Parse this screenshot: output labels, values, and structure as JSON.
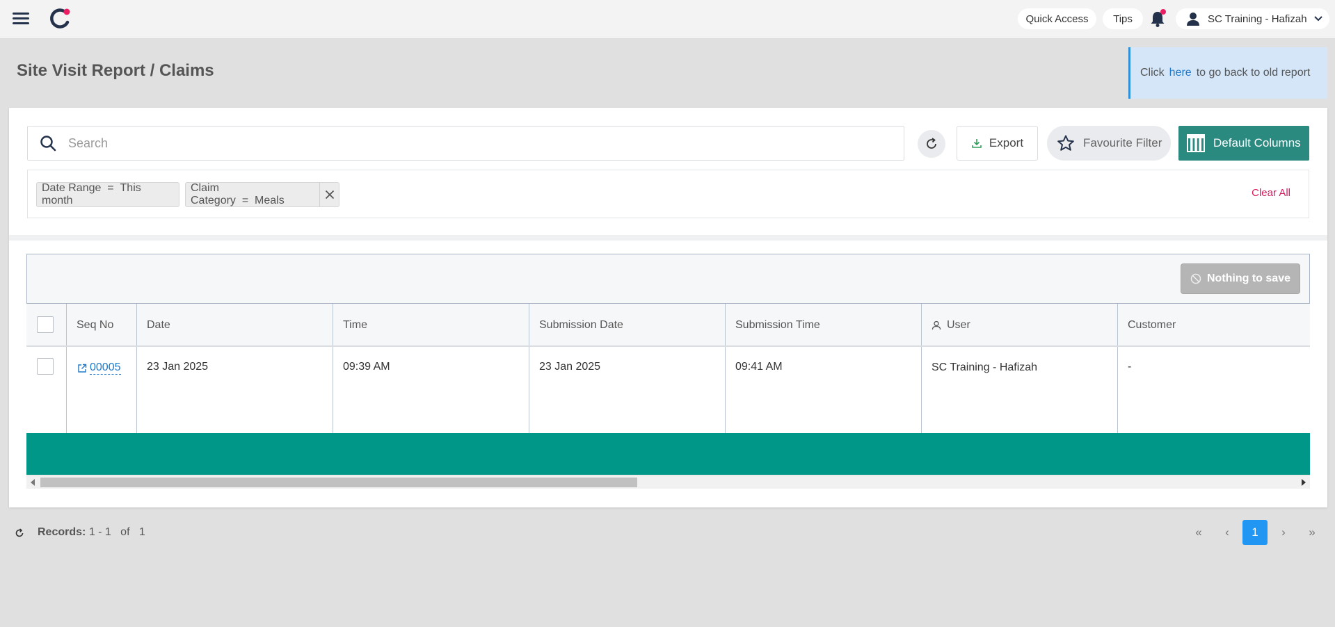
{
  "topbar": {
    "quick_access": "Quick Access",
    "tips": "Tips",
    "user_name": "SC Training - Hafizah",
    "logo_color": "#23314a",
    "logo_dot_color": "#e91e63"
  },
  "page": {
    "title": "Site Visit Report / Claims"
  },
  "notice": {
    "prefix": "Click",
    "link": "here",
    "suffix": "to go back to old report"
  },
  "toolbar": {
    "search_placeholder": "Search",
    "search_value": "",
    "export_label": "Export",
    "favourite_label": "Favourite Filter",
    "columns_label": "Default Columns"
  },
  "filters": {
    "chips": [
      {
        "field": "Date Range",
        "op": "=",
        "value": "This month"
      },
      {
        "field": "Claim Category",
        "op": "=",
        "value": "Meals"
      }
    ],
    "clear_all": "Clear All"
  },
  "grid": {
    "save_label": "Nothing to save",
    "columns": [
      "Seq No",
      "Date",
      "Time",
      "Submission Date",
      "Submission Time",
      "User",
      "Customer"
    ],
    "rows": [
      {
        "seq_no": "00005",
        "date": "23 Jan 2025",
        "time": "09:39 AM",
        "submission_date": "23 Jan 2025",
        "submission_time": "09:41 AM",
        "user": "SC Training - Hafizah",
        "customer": "-"
      }
    ]
  },
  "pagination": {
    "records_label": "Records:",
    "range": "1 - 1",
    "of_label": "of",
    "total": "1",
    "current_page": "1",
    "first": "«",
    "prev": "‹",
    "next": "›",
    "last": "»"
  },
  "colors": {
    "accent_teal": "#2a8a80",
    "bar_teal": "#009688",
    "page_active": "#2196f3",
    "clear_all": "#d81b60",
    "link": "#1f78c8"
  }
}
